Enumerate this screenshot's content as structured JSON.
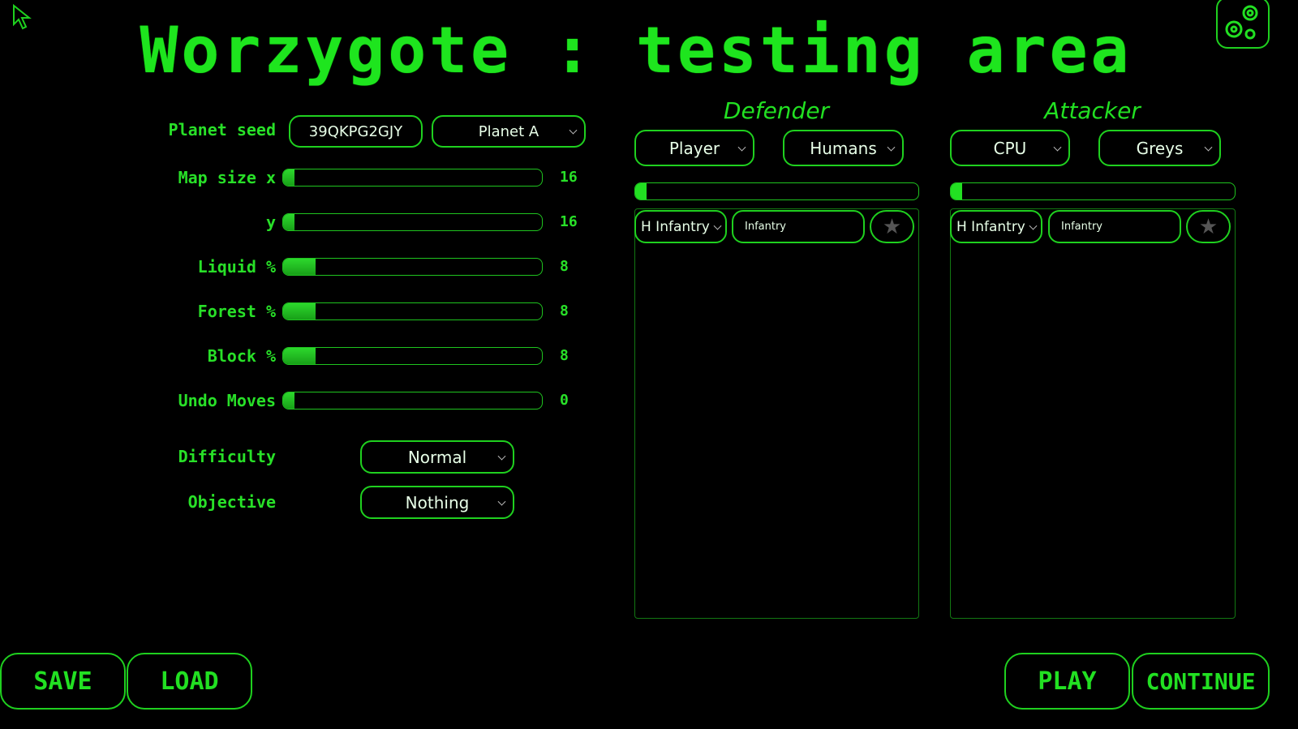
{
  "title": "Worzygote : testing area",
  "icons": {
    "cursor": "arrow-cursor-icon",
    "settings": "gear-icon",
    "favorite": "star-icon"
  },
  "colors": {
    "accent": "#22e022",
    "background": "#000000"
  },
  "settings": {
    "planet_seed_label": "Planet seed",
    "planet_seed_value": "39QKPG2GJY",
    "planet_type": "Planet A",
    "sliders": [
      {
        "label": "Map size x",
        "value": "16",
        "level": 0.0
      },
      {
        "label": "y",
        "value": "16",
        "level": 0.0
      },
      {
        "label": "Liquid %",
        "value": "8",
        "level": 0.08
      },
      {
        "label": "Forest %",
        "value": "8",
        "level": 0.08
      },
      {
        "label": "Block %",
        "value": "8",
        "level": 0.08
      },
      {
        "label": "Undo Moves",
        "value": "0",
        "level": 0.0
      }
    ],
    "difficulty_label": "Difficulty",
    "difficulty_value": "Normal",
    "objective_label": "Objective",
    "objective_value": "Nothing"
  },
  "defender": {
    "title": "Defender",
    "controller": "Player",
    "faction": "Humans",
    "budget_level": 0.0,
    "unit_type": "H Infantry",
    "unit_name": "Infantry"
  },
  "attacker": {
    "title": "Attacker",
    "controller": "CPU",
    "faction": "Greys",
    "budget_level": 0.0,
    "unit_type": "H Infantry",
    "unit_name": "Infantry"
  },
  "buttons": {
    "save": "SAVE",
    "load": "LOAD",
    "play": "PLAY",
    "continue": "CONTINUE"
  }
}
